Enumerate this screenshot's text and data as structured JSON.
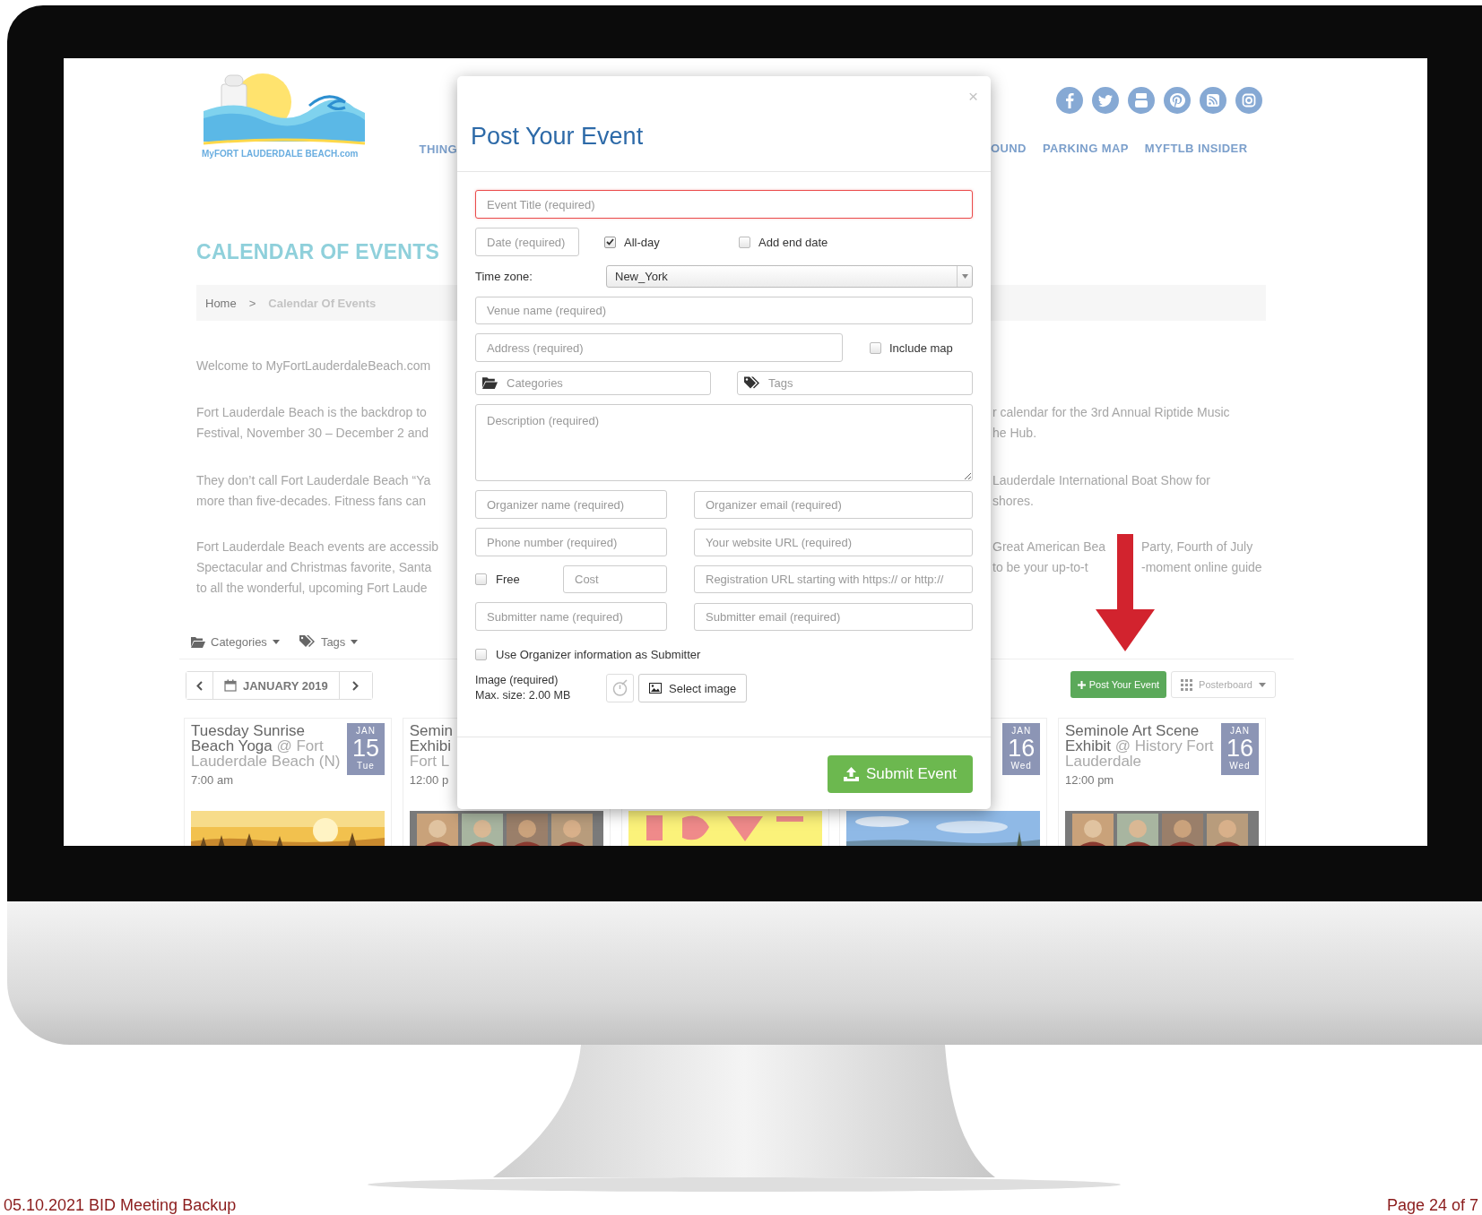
{
  "site": {
    "logo_text": "MyFORT LAUDERDALE BEACH.com",
    "nav_left": [
      "THING"
    ],
    "nav_right": [
      "OUND",
      "PARKING MAP",
      "MYFTLB INSIDER"
    ]
  },
  "heading": "CALENDAR OF EVENTS",
  "breadcrumb": {
    "separator": ">",
    "items": [
      {
        "label": "Home",
        "current": false
      },
      {
        "label": "Calendar Of Events",
        "current": true
      }
    ]
  },
  "intro": [
    {
      "left": [
        "Welcome to MyFortLauderdaleBeach.com"
      ]
    },
    {
      "left": [
        "Fort Lauderdale Beach is the backdrop to",
        "Festival, November 30 – December 2 and"
      ],
      "right": [
        [
          "r calendar for the 3rd Annual Riptide Music"
        ],
        [
          "he Hub."
        ]
      ]
    },
    {
      "left": [
        "They don’t call Fort Lauderdale Beach “Ya",
        "more than five-decades. Fitness fans can"
      ],
      "right": [
        [
          "Lauderdale International Boat Show for"
        ],
        [
          "shores."
        ]
      ]
    },
    {
      "left": [
        "Fort Lauderdale Beach events are accessib",
        "Spectacular and Christmas favorite, Santa",
        "to all the wonderful, upcoming Fort Laude"
      ],
      "right": [
        [
          "Great American Bea",
          "Party, Fourth of July"
        ],
        [
          "to be your up-to-t",
          "-moment online guide"
        ]
      ]
    }
  ],
  "filters": [
    {
      "label": "Categories",
      "kind": "categories"
    },
    {
      "label": "Tags",
      "kind": "tags"
    }
  ],
  "month": "JANUARY 2019",
  "post_button": "Post Your Event",
  "view_button": "Posterboard",
  "events": [
    {
      "kind": "full",
      "title": "Tuesday Sunrise Beach Yoga",
      "venue": "@ Fort Lauderdale Beach (N)",
      "time": "7:00 am",
      "month": "JAN",
      "day": "15",
      "weekday": "Tue"
    },
    {
      "kind": "clipped",
      "title": "Semin Exhibi",
      "venue": "Fort L",
      "time": "12:00 p"
    },
    {
      "kind": "picture"
    },
    {
      "kind": "badge",
      "month": "JAN",
      "day": "16",
      "weekday": "Wed"
    },
    {
      "kind": "full",
      "title": "Seminole Art Scene Exhibit",
      "venue": "@ History Fort Lauderdale",
      "time": "12:00 pm",
      "month": "JAN",
      "day": "16",
      "weekday": "Wed"
    }
  ],
  "modal": {
    "title": "Post Your Event",
    "close": "×",
    "event_title": {
      "placeholder": "Event Title (required)",
      "invalid": true
    },
    "date": {
      "placeholder": "Date (required)"
    },
    "all_day": {
      "label": "All-day",
      "checked": true
    },
    "end_date": {
      "label": "Add end date",
      "checked": false
    },
    "timezone": {
      "label": "Time zone:",
      "value": "New_York"
    },
    "venue": {
      "placeholder": "Venue name (required)"
    },
    "address": {
      "placeholder": "Address (required)"
    },
    "include_map": {
      "label": "Include map",
      "checked": false
    },
    "categories": {
      "placeholder": "Categories"
    },
    "tags": {
      "placeholder": "Tags"
    },
    "description": {
      "placeholder": "Description (required)"
    },
    "organizer_name": {
      "placeholder": "Organizer name (required)"
    },
    "organizer_email": {
      "placeholder": "Organizer email (required)"
    },
    "phone": {
      "placeholder": "Phone number (required)"
    },
    "website": {
      "placeholder": "Your website URL (required)"
    },
    "free": {
      "label": "Free",
      "checked": false
    },
    "cost": {
      "placeholder": "Cost"
    },
    "registration_url": {
      "placeholder": "Registration URL starting with https:// or http://"
    },
    "submitter_name": {
      "placeholder": "Submitter name (required)"
    },
    "submitter_email": {
      "placeholder": "Submitter email (required)"
    },
    "use_organizer": {
      "label": "Use Organizer information as Submitter",
      "checked": false
    },
    "image_label": "Image (required)",
    "image_size": "Max. size: 2.00 MB",
    "select_image": "Select image",
    "submit": "Submit Event"
  },
  "footer": {
    "document": "05.10.2021 BID Meeting Backup",
    "page": "Page 24 of 7"
  }
}
